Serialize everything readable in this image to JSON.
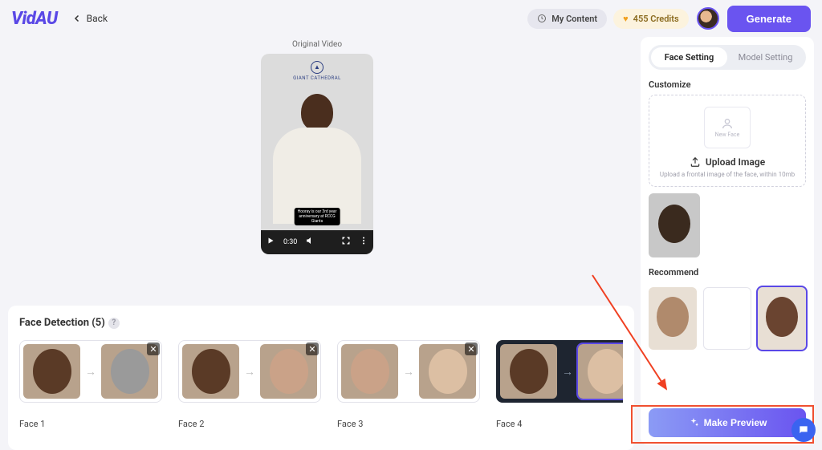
{
  "brand": "VidAU",
  "back_label": "Back",
  "topbar": {
    "my_content": "My Content",
    "credits": "455 Credits",
    "generate": "Generate"
  },
  "preview": {
    "label": "Original Video",
    "channel": "GIANT CATHEDRAL",
    "caption": "Hooray is our 3rd year\nanniversary at RCCG\nGiants",
    "time": "0:30"
  },
  "face_detection": {
    "title": "Face Detection (5)",
    "items": [
      {
        "label": "Face 1"
      },
      {
        "label": "Face 2"
      },
      {
        "label": "Face 3"
      },
      {
        "label": "Face 4"
      }
    ]
  },
  "sidebar": {
    "tab_face": "Face Setting",
    "tab_model": "Model Setting",
    "customize": "Customize",
    "new_face": "New Face",
    "upload": "Upload Image",
    "upload_hint": "Upload a frontal image of the face, within 10mb",
    "recommend": "Recommend",
    "make_preview": "Make Preview"
  }
}
